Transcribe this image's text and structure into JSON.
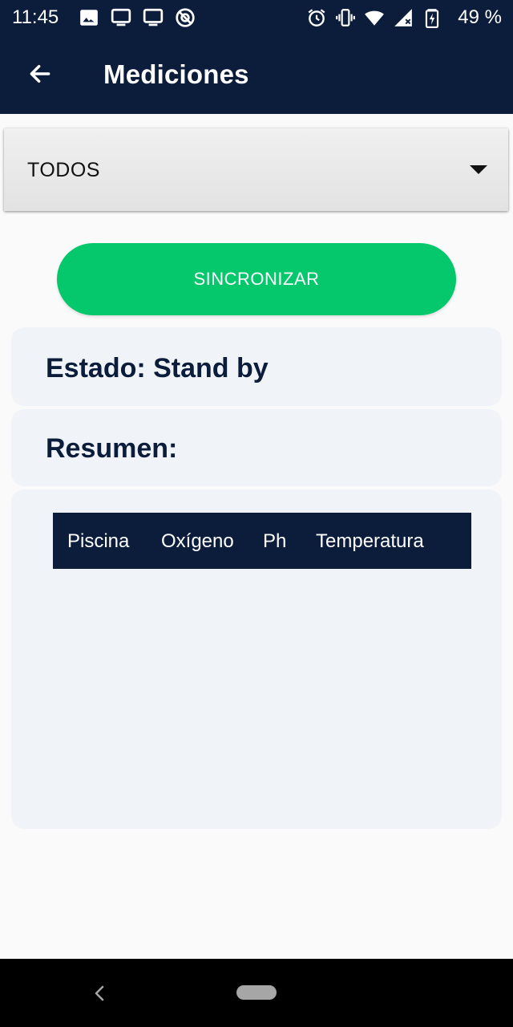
{
  "status_bar": {
    "time": "11:45",
    "battery_percent": "49 %",
    "left_icons": [
      "image-icon",
      "monitor-icon",
      "monitor-icon",
      "blocked-icon"
    ],
    "right_icons": [
      "alarm-icon",
      "vibrate-icon",
      "wifi-icon",
      "signal-icon",
      "battery-icon"
    ]
  },
  "app_bar": {
    "title": "Mediciones",
    "back_icon": "arrow-back-icon"
  },
  "filter": {
    "selected": "TODOS"
  },
  "sync_button": {
    "label": "SINCRONIZAR",
    "color": "#05c76b"
  },
  "estado": {
    "text": "Estado: Stand by"
  },
  "resumen": {
    "text": "Resumen:"
  },
  "table": {
    "columns": [
      "Piscina",
      "Oxígeno",
      "Ph",
      "Temperatura"
    ],
    "rows": []
  },
  "colors": {
    "primary_dark": "#0b1d3a",
    "card_bg": "#f0f4f8",
    "page_bg": "#fafafa"
  }
}
